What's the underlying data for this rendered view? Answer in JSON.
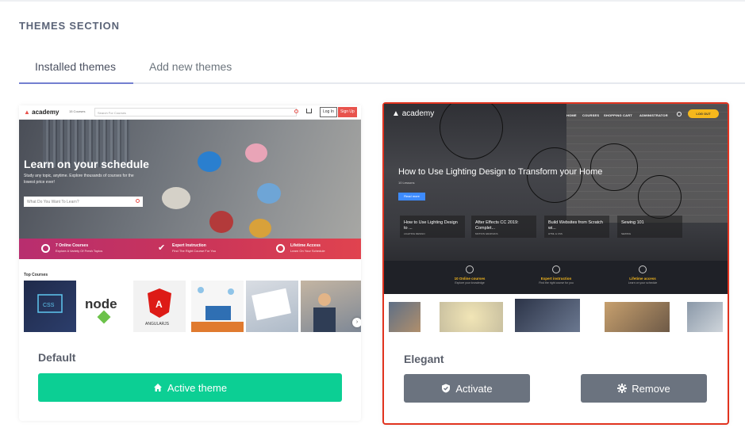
{
  "page": {
    "section_title": "THEMES SECTION"
  },
  "tabs": [
    {
      "label": "Installed themes",
      "active": true
    },
    {
      "label": "Add new themes",
      "active": false
    }
  ],
  "themes": {
    "default": {
      "name": "Default",
      "action_label": "Active theme",
      "action_icon": "home-icon",
      "accent": "#0ccf94",
      "preview": {
        "logo": "academy",
        "nav_courses": "15 Courses",
        "search_placeholder": "Search For Courses",
        "login": "Log In",
        "signup": "Sign Up",
        "hero_title": "Learn on your schedule",
        "hero_subtitle": "Study any topic, anytime. Explore thousands of courses for the lowest price ever!",
        "hero_search_placeholder": "What Do You Want To Learn?",
        "features": [
          {
            "title": "7 Online Courses",
            "subtitle": "Explore A Variety Of Fresh Topics",
            "icon": "target-icon"
          },
          {
            "title": "Expert Instruction",
            "subtitle": "Find The Right Course For You",
            "icon": "check-icon"
          },
          {
            "title": "Lifetime Access",
            "subtitle": "Learn On Your Schedule",
            "icon": "clock-icon"
          }
        ],
        "top_courses_label": "Top Courses",
        "tile_labels": {
          "node": "node",
          "angular": "ANGULARJS"
        },
        "brand_color": "#e8534d"
      }
    },
    "elegant": {
      "name": "Elegant",
      "selected": true,
      "actions": [
        {
          "label": "Activate",
          "icon": "shield-check-icon"
        },
        {
          "label": "Remove",
          "icon": "gear-icon"
        }
      ],
      "highlight_color": "#e1331f",
      "preview": {
        "logo": "academy",
        "nav": [
          "HOME",
          "COURSES",
          "SHOPPING CART",
          "ADMINISTRATOR"
        ],
        "logout": "LOG OUT",
        "hero_title": "How to Use Lighting Design to Transform your Home",
        "lessons": "10 Lessons",
        "read_more": "Read more",
        "courses": [
          {
            "title": "How to Use Lighting Design to ...",
            "sub": "LIGHTING DESIGN"
          },
          {
            "title": "After Effects CC 2019: Complet...",
            "sub": "MOTION GRAPHICS"
          },
          {
            "title": "Build Websites from Scratch wi...",
            "sub": "HTML & CSS"
          },
          {
            "title": "Sewing 101",
            "sub": "SEWING"
          }
        ],
        "features": [
          {
            "title": "10 Online courses",
            "subtitle": "Explore your knowledge",
            "icon": "graduation-cap-icon"
          },
          {
            "title": "Expert instruction",
            "subtitle": "Find the right course for you",
            "icon": "trophy-icon"
          },
          {
            "title": "Lifetime access",
            "subtitle": "Learn on your schedule",
            "icon": "fingerprint-icon"
          }
        ],
        "accent": "#f6b81c"
      }
    }
  }
}
